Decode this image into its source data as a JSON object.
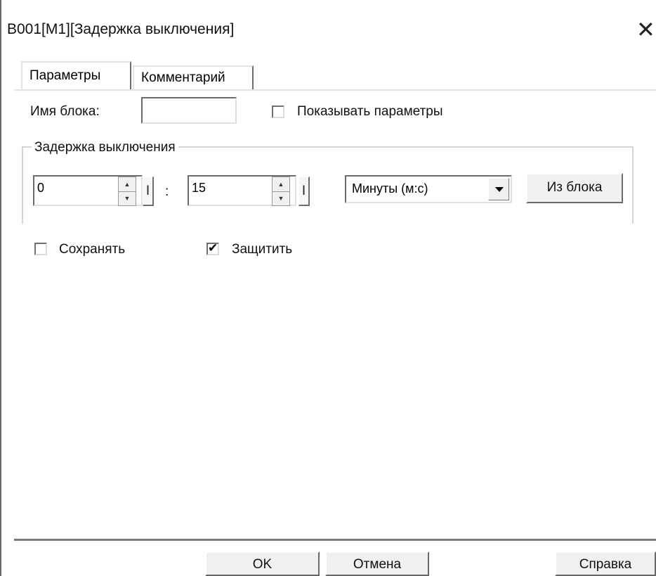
{
  "window": {
    "title": "B001[M1][Задержка выключения]",
    "close_glyph": "✕"
  },
  "tabs": [
    {
      "label": "Параметры"
    },
    {
      "label": "Комментарий"
    }
  ],
  "block_name": {
    "label": "Имя блока:",
    "value": ""
  },
  "show_params": {
    "label": "Показывать параметры",
    "checked": false
  },
  "delay_group": {
    "legend": "Задержка выключения",
    "minutes_value": "0",
    "separator": ":",
    "seconds_value": "15",
    "pipe_label": "I",
    "spin_up": "▲",
    "spin_down": "▼",
    "unit_selected": "Минуты (м:с)",
    "from_block_button": "Из блока"
  },
  "options": {
    "retain": {
      "label": "Сохранять",
      "checked": false
    },
    "protect": {
      "label": "Защитить",
      "checked": true
    }
  },
  "footer": {
    "ok": "OK",
    "cancel": "Отмена",
    "help": "Справка"
  }
}
